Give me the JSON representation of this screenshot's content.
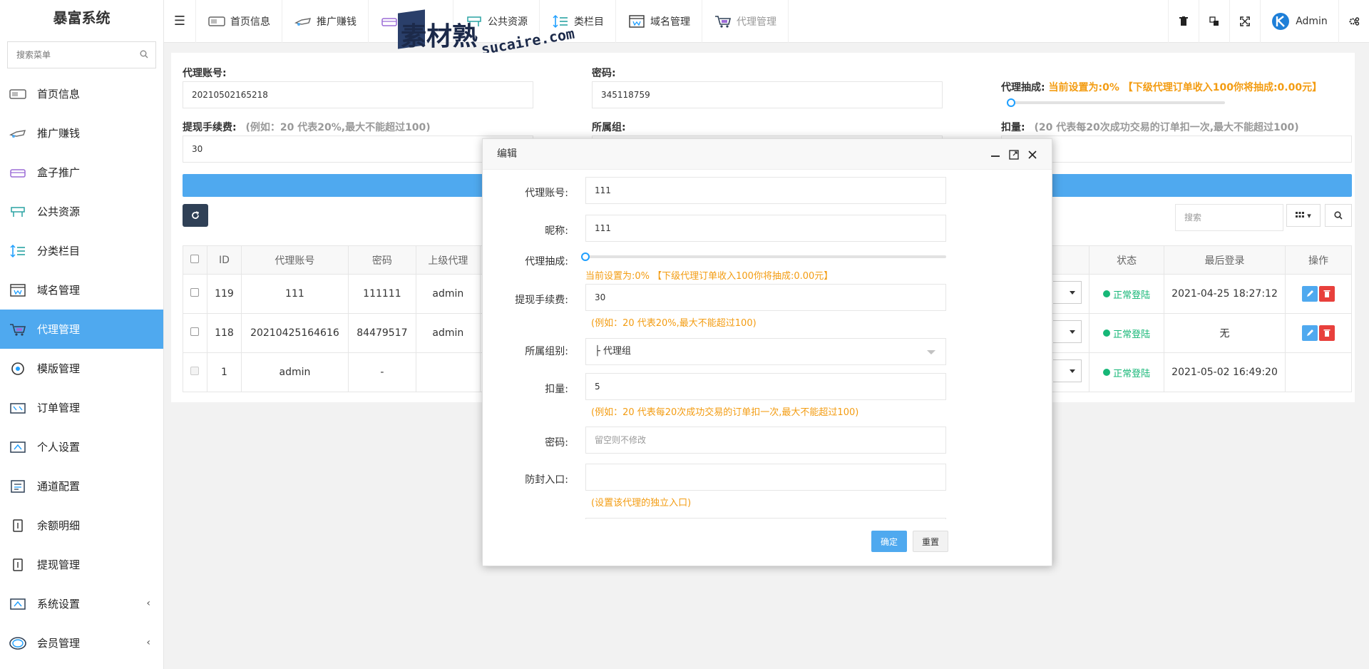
{
  "app": {
    "title": "暴富系统"
  },
  "sidebar": {
    "search_placeholder": "搜索菜单",
    "items": [
      {
        "label": "首页信息",
        "icon": "home-card-icon"
      },
      {
        "label": "推广赚钱",
        "icon": "promo-icon"
      },
      {
        "label": "盒子推广",
        "icon": "box-icon"
      },
      {
        "label": "公共资源",
        "icon": "resource-icon"
      },
      {
        "label": "分类栏目",
        "icon": "category-icon"
      },
      {
        "label": "域名管理",
        "icon": "domain-icon"
      },
      {
        "label": "代理管理",
        "icon": "agent-cart-icon"
      },
      {
        "label": "模版管理",
        "icon": "template-icon"
      },
      {
        "label": "订单管理",
        "icon": "order-icon"
      },
      {
        "label": "个人设置",
        "icon": "profile-icon"
      },
      {
        "label": "通道配置",
        "icon": "channel-icon"
      },
      {
        "label": "余额明细",
        "icon": "balance-icon"
      },
      {
        "label": "提现管理",
        "icon": "withdraw-icon"
      },
      {
        "label": "系统设置",
        "icon": "system-icon"
      },
      {
        "label": "会员管理",
        "icon": "member-icon"
      }
    ],
    "active_index": 6,
    "caret": "‹"
  },
  "topnav": {
    "items": [
      "首页信息",
      "推广赚钱",
      "盒",
      "公共资源",
      "类栏目",
      "域名管理",
      "代理管理"
    ],
    "admin_label": "Admin"
  },
  "watermark": {
    "cn": "素材熟",
    "en": "sucaire.com"
  },
  "form": {
    "account_label": "代理账号:",
    "account_value": "20210502165218",
    "password_label": "密码:",
    "password_value": "345118759",
    "commission_label": "代理抽成:",
    "commission_status": "当前设置为:0% 【下级代理订单收入100你将抽成:0.00元】",
    "commission_percent": 0,
    "fee_label": "提现手续费:",
    "fee_hint": "(例如：20 代表20%,最大不能超过100)",
    "fee_value": "30",
    "group_label": "所属组:",
    "deduct_label": "扣量:",
    "deduct_hint": "(20 代表每20次成功交易的订单扣一次,最大不能超过100)"
  },
  "table": {
    "search_placeholder": "搜索",
    "headers": [
      "ID",
      "代理账号",
      "密码",
      "上级代理",
      "状态",
      "最后登录",
      "操作"
    ],
    "rows": [
      {
        "id": "119",
        "account": "111",
        "password": "111111",
        "parent": "admin",
        "status": "正常登陆",
        "last_login": "2021-04-25 18:27:12",
        "ops": true
      },
      {
        "id": "118",
        "account": "20210425164616",
        "password": "84479517",
        "parent": "admin",
        "status": "正常登陆",
        "last_login": "无",
        "ops": true
      },
      {
        "id": "1",
        "account": "admin",
        "password": "-",
        "parent": "",
        "status": "正常登陆",
        "last_login": "2021-05-02 16:49:20",
        "ops": false
      }
    ]
  },
  "modal": {
    "title": "编辑",
    "fields": {
      "account_label": "代理账号:",
      "account_value": "111",
      "nick_label": "昵称:",
      "nick_value": "111",
      "commission_label": "代理抽成:",
      "commission_status": "当前设置为:0% 【下级代理订单收入100你将抽成:0.00元】",
      "commission_percent": 0,
      "fee_label": "提现手续费:",
      "fee_value": "30",
      "fee_hint": "(例如：20 代表20%,最大不能超过100)",
      "group_label": "所属组别:",
      "group_value": "├ 代理组",
      "deduct_label": "扣量:",
      "deduct_value": "5",
      "deduct_hint": "(例如：20 代表每20次成功交易的订单扣一次,最大不能超过100)",
      "password_label": "密码:",
      "password_placeholder": "留空则不修改",
      "entry_label": "防封入口:",
      "entry_value": "",
      "entry_hint": "(设置该代理的独立入口)"
    },
    "ok_label": "确定",
    "reset_label": "重置"
  },
  "colors": {
    "accent": "#4fa9ef",
    "orange": "#f39c12",
    "success": "#16b777",
    "danger": "#e8403c",
    "dark": "#2f4056"
  }
}
